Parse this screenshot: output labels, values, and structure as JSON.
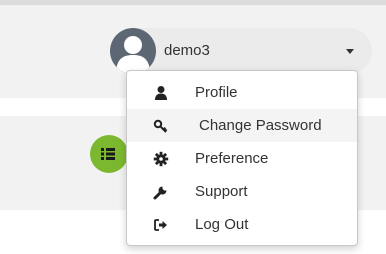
{
  "user": {
    "name": "demo3",
    "avatar_icon": "user-silhouette",
    "dropdown_icon": "caret-down"
  },
  "menu": {
    "items": [
      {
        "label": "Profile",
        "icon": "user-icon"
      },
      {
        "label": "Change Password",
        "icon": "key-icon"
      },
      {
        "label": "Preference",
        "icon": "gear-icon"
      },
      {
        "label": "Support",
        "icon": "wrench-icon"
      },
      {
        "label": "Log Out",
        "icon": "sign-out-icon"
      }
    ]
  },
  "panel": {
    "badge_icon": "list-icon",
    "badge_color": "#7cb82f"
  },
  "colors": {
    "header_bg": "#f2f2f2",
    "pill_bg": "#ebebeb",
    "avatar_bg": "#5d6774",
    "text": "#333333"
  }
}
